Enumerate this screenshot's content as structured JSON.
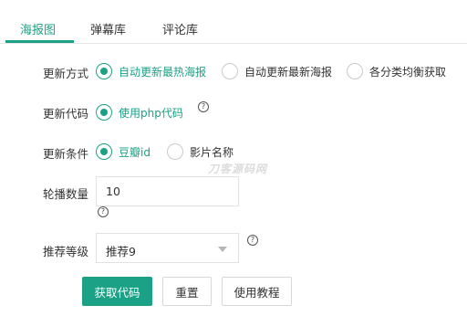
{
  "tabs": [
    {
      "label": "海报图",
      "active": true
    },
    {
      "label": "弹幕库",
      "active": false
    },
    {
      "label": "评论库",
      "active": false
    }
  ],
  "update_mode": {
    "label": "更新方式",
    "options": [
      {
        "label": "自动更新最热海报",
        "checked": true
      },
      {
        "label": "自动更新最新海报",
        "checked": false
      },
      {
        "label": "各分类均衡获取",
        "checked": false
      }
    ]
  },
  "update_code": {
    "label": "更新代码",
    "options": [
      {
        "label": "使用php代码",
        "checked": true
      }
    ],
    "help": "?"
  },
  "update_condition": {
    "label": "更新条件",
    "options": [
      {
        "label": "豆瓣id",
        "checked": true
      },
      {
        "label": "影片名称",
        "checked": false
      }
    ]
  },
  "carousel_count": {
    "label": "轮播数量",
    "value": "10",
    "help": "?"
  },
  "recommend_level": {
    "label": "推荐等级",
    "selected": "推荐9",
    "help": "?"
  },
  "buttons": {
    "get_code": "获取代码",
    "reset": "重置",
    "tutorial": "使用教程"
  },
  "watermark": "刀客源码网",
  "colors": {
    "accent": "#1aa186",
    "border": "#e2e2e2",
    "text": "#333333"
  }
}
